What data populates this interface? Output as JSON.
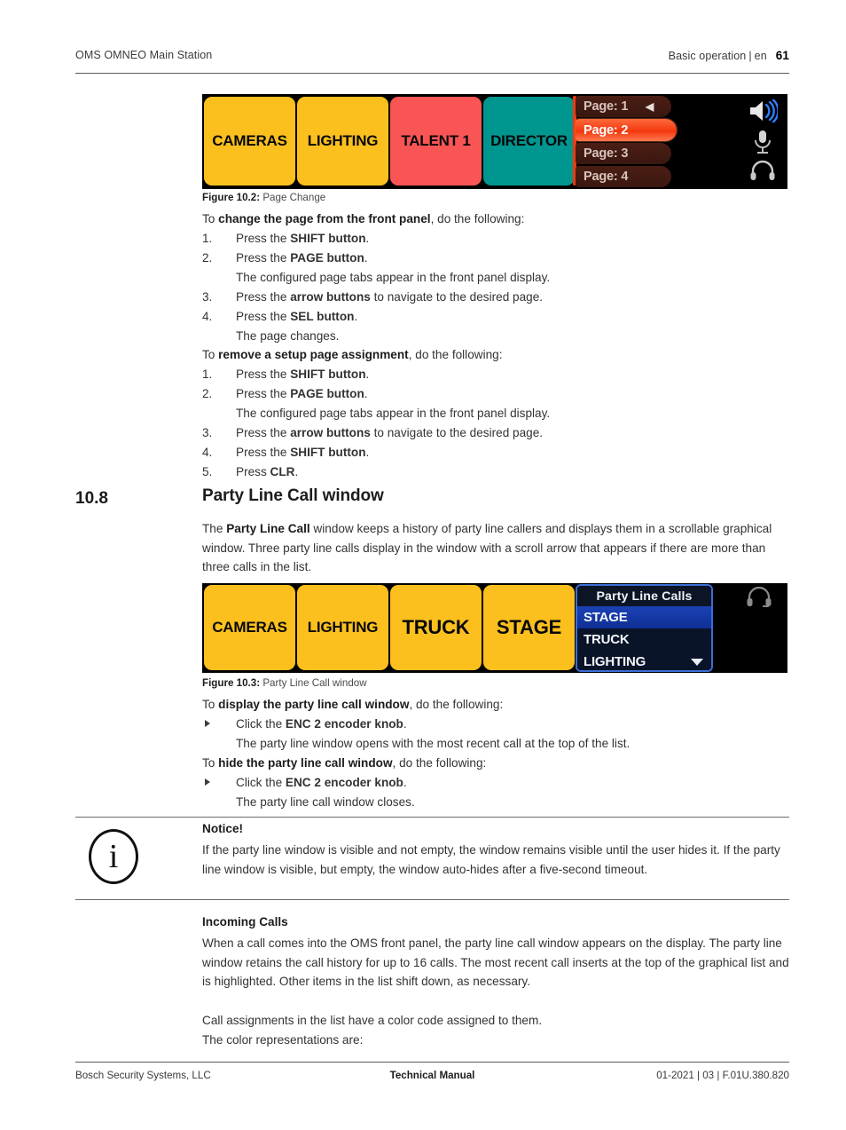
{
  "header": {
    "left": "OMS OMNEO Main Station",
    "section": "Basic operation",
    "lang": "en",
    "page_number": "61",
    "separator": "|"
  },
  "figure_page_change": {
    "caption_label": "Figure 10.2:",
    "caption_text": "Page Change",
    "keys": [
      {
        "label": "CAMERAS",
        "color": "#FBC01E"
      },
      {
        "label": "LIGHTING",
        "color": "#FBC01E"
      },
      {
        "label": "TALENT 1",
        "color": "#FA5555"
      },
      {
        "label": "DIRECTOR",
        "color": "#009690"
      }
    ],
    "page_tabs": [
      {
        "label": "Page: 1",
        "active": false,
        "arrow": "◀"
      },
      {
        "label": "Page: 2",
        "active": true,
        "arrow": ""
      },
      {
        "label": "Page: 3",
        "active": false,
        "arrow": ""
      },
      {
        "label": "Page: 4",
        "active": false,
        "arrow": ""
      }
    ],
    "status_icons": [
      "speaker-icon",
      "microphone-icon",
      "headset-icon"
    ]
  },
  "procedure_change_page": {
    "intro_prefix": "To ",
    "intro_bold": "change the page from the front panel",
    "intro_suffix": ", do the following:",
    "steps": [
      {
        "num": "1.",
        "prefix": "Press the ",
        "bold": "SHIFT button",
        "suffix": ".",
        "result": ""
      },
      {
        "num": "2.",
        "prefix": "Press the ",
        "bold": "PAGE button",
        "suffix": ".",
        "result": "The configured page tabs appear in the front panel display."
      },
      {
        "num": "3.",
        "prefix": "Press the ",
        "bold": "arrow buttons",
        "suffix": " to navigate to the desired page.",
        "result": ""
      },
      {
        "num": "4.",
        "prefix": "Press the ",
        "bold": "SEL button",
        "suffix": ".",
        "result": "The page changes."
      }
    ]
  },
  "procedure_remove_assignment": {
    "intro_prefix": "To ",
    "intro_bold": "remove a setup page assignment",
    "intro_suffix": ", do the following:",
    "steps": [
      {
        "num": "1.",
        "prefix": "Press the ",
        "bold": "SHIFT button",
        "suffix": ".",
        "result": ""
      },
      {
        "num": "2.",
        "prefix": "Press the ",
        "bold": "PAGE button",
        "suffix": ".",
        "result": "The configured page tabs appear in the front panel display."
      },
      {
        "num": "3.",
        "prefix": "Press the ",
        "bold": "arrow buttons",
        "suffix": " to navigate to the desired page.",
        "result": ""
      },
      {
        "num": "4.",
        "prefix": "Press the ",
        "bold": "SHIFT button",
        "suffix": ".",
        "result": ""
      },
      {
        "num": "5.",
        "prefix": "Press ",
        "bold": "CLR",
        "suffix": ".",
        "result": ""
      }
    ]
  },
  "section": {
    "number": "10.8",
    "title": "Party Line Call window",
    "intro_part1": "The ",
    "intro_bold": "Party Line Call",
    "intro_part2": " window keeps a history of party line callers and displays them in a scrollable graphical window. Three party line calls display in the window with a scroll arrow that appears if there are more than three calls in the list."
  },
  "figure_party_line": {
    "caption_label": "Figure 10.3:",
    "caption_text": "Party Line Call window",
    "keys": [
      {
        "label": "CAMERAS",
        "color": "#FBC01E"
      },
      {
        "label": "LIGHTING",
        "color": "#FBC01E"
      },
      {
        "label": "TRUCK",
        "color": "#FBC01E"
      },
      {
        "label": "STAGE",
        "color": "#FBC01E"
      }
    ],
    "popup_title": "Party Line Calls",
    "popup_rows": [
      {
        "label": "STAGE",
        "selected": true
      },
      {
        "label": "TRUCK",
        "selected": false
      },
      {
        "label": "LIGHTING",
        "selected": false,
        "has_scroll_caret": true
      }
    ],
    "status_icons": [
      "headset-icon"
    ]
  },
  "procedure_display_window": {
    "intro_prefix": "To ",
    "intro_bold": "display the party line call window",
    "intro_suffix": ", do the following:",
    "step_prefix": "Click the ",
    "step_bold": "ENC 2 encoder knob",
    "step_suffix": ".",
    "result": "The party line window opens with the most recent call at the top of the list."
  },
  "procedure_hide_window": {
    "intro_prefix": "To ",
    "intro_bold": "hide the party line call window",
    "intro_suffix": ", do the following:",
    "step_prefix": "Click the ",
    "step_bold": "ENC 2 encoder knob",
    "step_suffix": ".",
    "result": "The party line call window closes."
  },
  "notice": {
    "icon": "information-icon",
    "glyph": "i",
    "heading": "Notice!",
    "body": "If the party line window is visible and not empty, the window remains visible until the user hides it. If the party line window is visible, but empty, the window auto-hides after a five-second timeout."
  },
  "incoming_calls": {
    "heading": "Incoming Calls",
    "paragraph": "When a call comes into the OMS front panel, the party line call window appears on the display. The party line window retains the call history for up to 16 calls. The most recent call inserts at the top of the graphical list and is highlighted. Other items in the list shift down, as necessary.",
    "line2": "Call assignments in the list have a color code assigned to them.",
    "line3": "The color representations are:"
  },
  "footer": {
    "left": "Bosch Security Systems, LLC",
    "center": "Technical Manual",
    "right": "01-2021 | 03 | F.01U.380.820"
  }
}
